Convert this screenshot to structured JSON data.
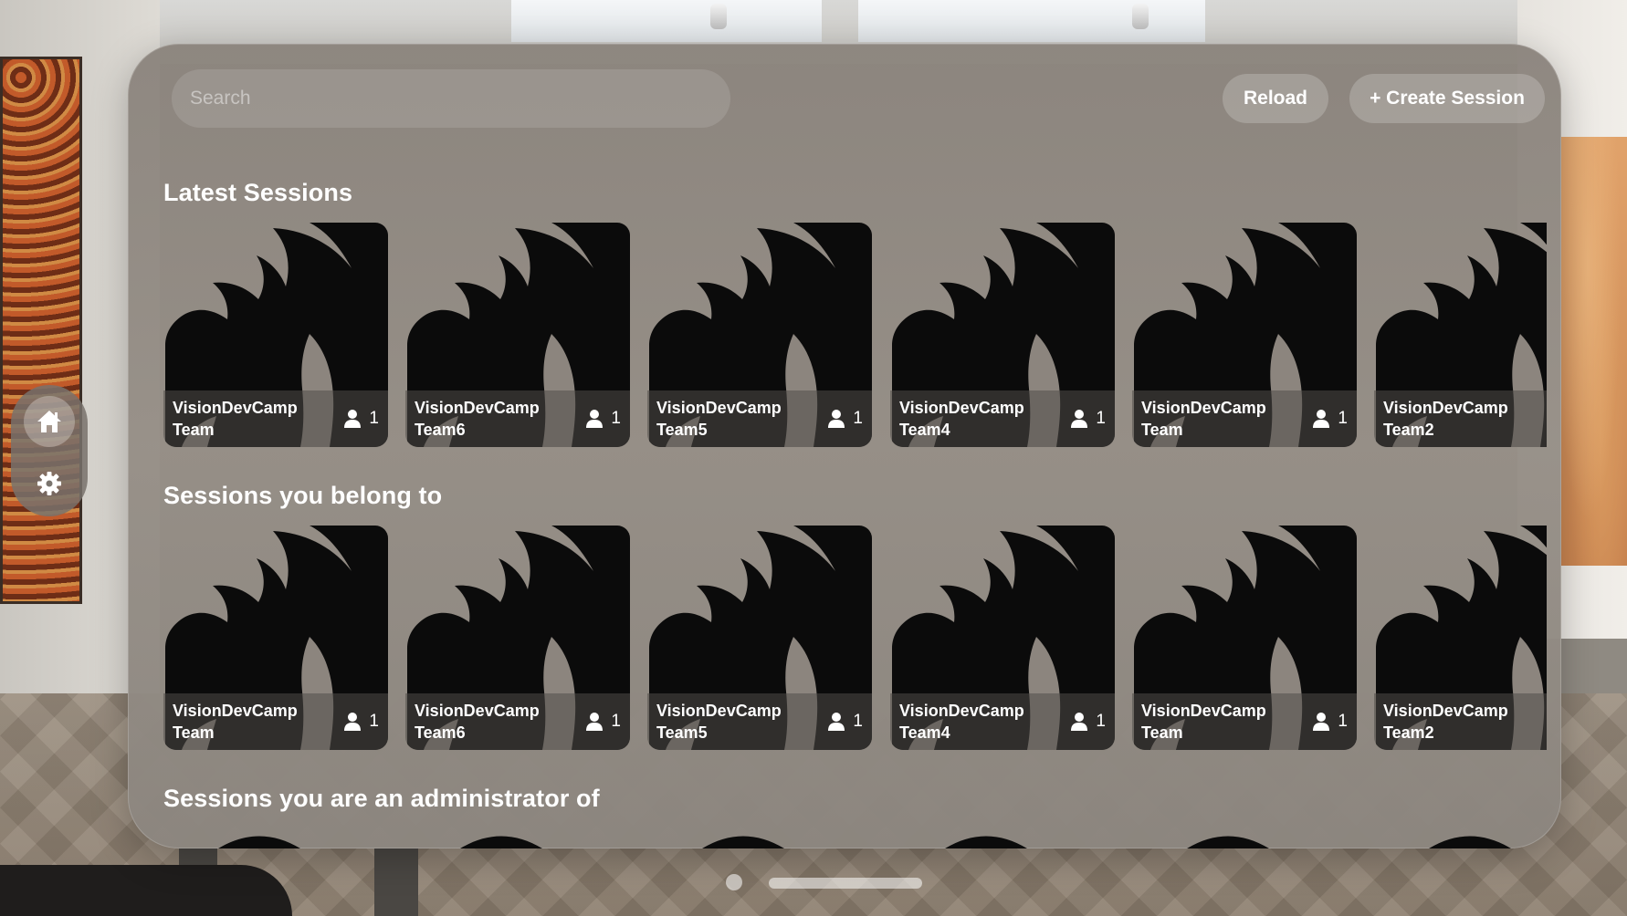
{
  "search": {
    "placeholder": "Search",
    "value": ""
  },
  "toolbar": {
    "reload_label": "Reload",
    "create_label": "+ Create Session"
  },
  "sections": [
    {
      "title": "Latest Sessions",
      "cards": [
        {
          "name": "VisionDevCamp Team",
          "members": "1"
        },
        {
          "name": "VisionDevCamp Team6",
          "members": "1"
        },
        {
          "name": "VisionDevCamp Team5",
          "members": "1"
        },
        {
          "name": "VisionDevCamp Team4",
          "members": "1"
        },
        {
          "name": "VisionDevCamp Team",
          "members": "1"
        },
        {
          "name": "VisionDevCamp Team2",
          "members": ""
        }
      ]
    },
    {
      "title": "Sessions you belong to",
      "cards": [
        {
          "name": "VisionDevCamp Team",
          "members": "1"
        },
        {
          "name": "VisionDevCamp Team6",
          "members": "1"
        },
        {
          "name": "VisionDevCamp Team5",
          "members": "1"
        },
        {
          "name": "VisionDevCamp Team4",
          "members": "1"
        },
        {
          "name": "VisionDevCamp Team",
          "members": "1"
        },
        {
          "name": "VisionDevCamp Team2",
          "members": ""
        }
      ]
    },
    {
      "title": "Sessions you are an administrator of",
      "cards": []
    }
  ],
  "sidebar": {
    "items": [
      {
        "icon": "home-icon",
        "selected": true
      },
      {
        "icon": "gear-icon",
        "selected": false
      }
    ]
  },
  "icons": {
    "card_logo": "swift-logo-icon",
    "members": "person-icon"
  },
  "colors": {
    "accent": "#ffffff",
    "window": "#8c857e",
    "card_logo": "#0b0b0b"
  }
}
